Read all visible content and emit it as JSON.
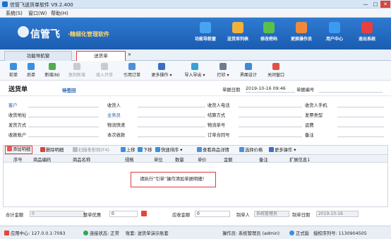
{
  "window": {
    "title": "信管飞送货单软件 V9.2.400",
    "min": "—",
    "max": "□",
    "close": "✕"
  },
  "menu": [
    "系统(S)",
    "窗口(W)",
    "帮助(H)"
  ],
  "banner": {
    "logo": "信管飞",
    "slogan": "·精细化管理软件",
    "nav": [
      "功能导航窗",
      "送货单列表",
      "修改密码",
      "更换操作员",
      "用户中心",
      "退出系统"
    ],
    "nav_colors": [
      "#4aa3f0",
      "#f2b13a",
      "#5cbf4a",
      "#f08a3a",
      "#3a9bf0",
      "#e84040"
    ]
  },
  "tabs": {
    "home": "功能导航窗",
    "current": "送货单",
    "close": "✕"
  },
  "toolbar": [
    "前单",
    "后单",
    "新增(N)",
    "复制新增",
    "填入开单",
    "引用订单",
    "更多操作",
    "导入导出",
    "打印",
    "界面设计",
    "关闭窗口"
  ],
  "form": {
    "title": "送货单",
    "status": "待签回",
    "date_label": "单据日期",
    "date_value": "2019-10-16 09:46",
    "no_label": "单据编号",
    "row1": [
      "客户",
      "收货人",
      "收货人电话",
      "收货人手机"
    ],
    "row2": [
      "收货地址",
      "业务员",
      "结算方式",
      "发票类型"
    ],
    "row3": [
      "发货方式",
      "物流快递",
      "物流单号",
      "运费"
    ],
    "row4": [
      "收款账户",
      "本次收款",
      "订单合同号",
      "备注"
    ]
  },
  "detailbar": [
    "添加明细",
    "删除明细",
    "扫描条形码(F4)",
    "上移",
    "下移",
    "快速排序",
    "查看商品详情",
    "选择价格",
    "更多操作"
  ],
  "grid": {
    "headers": [
      "序号",
      "商品编码",
      "商品名称",
      "规格",
      "单位",
      "数量",
      "单价",
      "金额",
      "备注",
      "扩展信息1"
    ],
    "hint": "请执行“引单”操作添加单据明细！"
  },
  "footer": {
    "total_label": "合计金额",
    "total_value": "0",
    "discount_label": "整单优惠",
    "discount_value": "0",
    "receivable_label": "应收金额",
    "receivable_value": "0",
    "creator_label": "制单人",
    "creator_value": "系统管理员",
    "created_label": "制单日期",
    "created_value": "2019-10-16"
  },
  "status": {
    "app_center": "应用中心: 127.0.0.1:7093",
    "conn": "连接状态: 正常",
    "account": "账套: 送货单演示账套",
    "operator": "操作员: 系统管理员 (admin)",
    "edition": "正式版",
    "license": "授权序列号: 1130904505"
  }
}
